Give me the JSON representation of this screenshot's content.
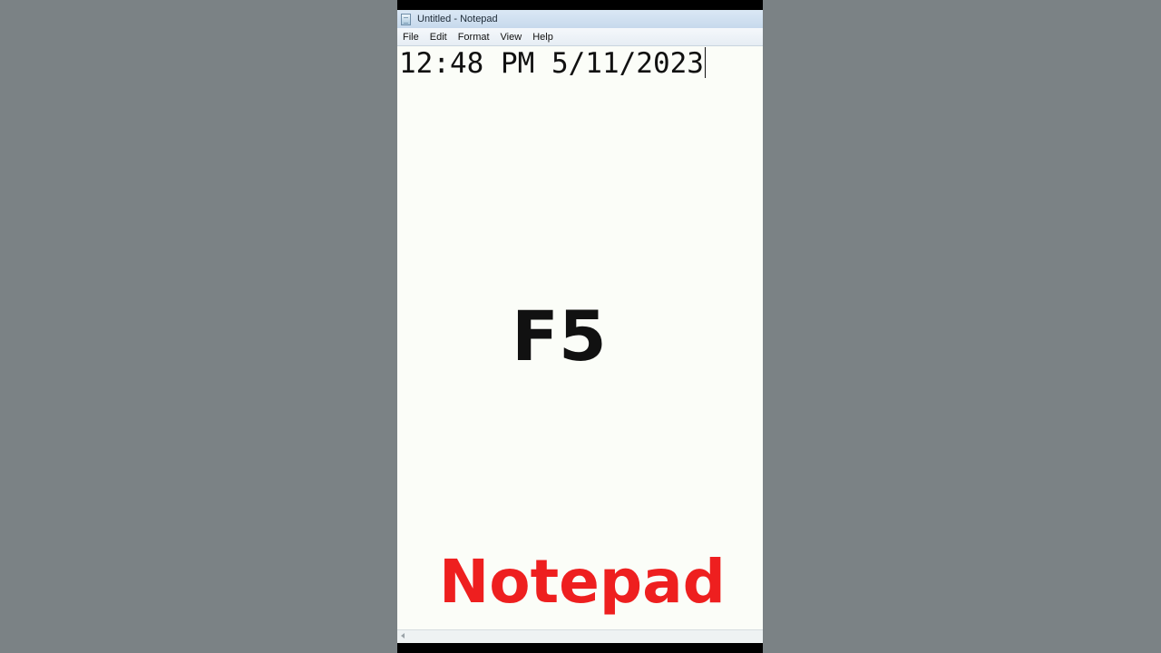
{
  "window": {
    "title": "Untitled - Notepad",
    "icon": "notepad-icon"
  },
  "menu": {
    "items": [
      "File",
      "Edit",
      "Format",
      "View",
      "Help"
    ]
  },
  "editor": {
    "content": "12:48 PM 5/11/2023"
  },
  "overlay": {
    "key": "F5",
    "title": "Notepad",
    "title_color": "#ee1f1f"
  }
}
